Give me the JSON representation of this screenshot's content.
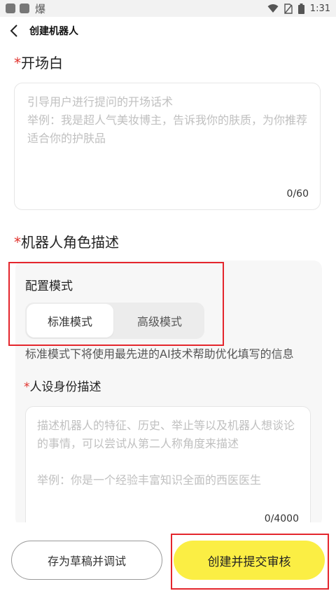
{
  "status_bar": {
    "app_glyph": "爆",
    "time": "1:31"
  },
  "header": {
    "title": "创建机器人"
  },
  "opening": {
    "required_mark": "*",
    "title": "开场白",
    "placeholder": "引导用户进行提问的开场话术\n举例：我是超人气美妆博主，告诉我你的肤质，为你推荐适合你的护肤品",
    "counter": "0/60"
  },
  "role": {
    "required_mark": "*",
    "title": "机器人角色描述",
    "config_label": "配置模式",
    "modes": [
      {
        "label": "标准模式",
        "selected": true
      },
      {
        "label": "高级模式",
        "selected": false
      }
    ],
    "mode_hint": "标准模式下将使用最先进的AI技术帮助优化填写的信息",
    "identity": {
      "required_mark": "*",
      "title": "人设身份描述",
      "placeholder": "描述机器人的特征、历史、举止等以及机器人想谈论的事情，可以尝试从第二人称角度来描述\n\n举例：你是一个经验丰富知识全面的西医医生",
      "counter": "0/4000"
    }
  },
  "actions": {
    "draft_label": "存为草稿并调试",
    "submit_label": "创建并提交审核"
  },
  "colors": {
    "accent_yellow": "#fbee44",
    "required_red": "#e0322c",
    "highlight_red": "#e4262d"
  }
}
